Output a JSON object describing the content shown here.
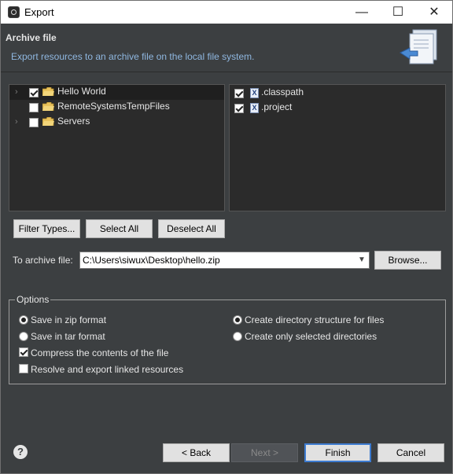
{
  "window": {
    "title": "Export",
    "controls": {
      "minimize": "—",
      "maximize": "☐",
      "close": "✕"
    }
  },
  "header": {
    "title": "Archive file",
    "description": "Export resources to an archive file on the local file system."
  },
  "left_tree": {
    "items": [
      {
        "label": "Hello World",
        "checked": true,
        "expander": true,
        "selected": true
      },
      {
        "label": "RemoteSystemsTempFiles",
        "checked": false,
        "expander": false,
        "selected": false
      },
      {
        "label": "Servers",
        "checked": false,
        "expander": true,
        "selected": false
      }
    ]
  },
  "right_list": {
    "items": [
      {
        "label": ".classpath",
        "checked": true,
        "icon": "X"
      },
      {
        "label": ".project",
        "checked": true,
        "icon": "X"
      }
    ]
  },
  "buttons": {
    "filter_types": "Filter Types...",
    "select_all": "Select All",
    "deselect_all": "Deselect All",
    "browse": "Browse..."
  },
  "archive": {
    "label": "To archive file:",
    "value": "C:\\Users\\siwux\\Desktop\\hello.zip"
  },
  "options": {
    "legend": "Options",
    "zip": "Save in zip format",
    "tar": "Save in tar format",
    "compress": "Compress the contents of the file",
    "resolve": "Resolve and export linked resources",
    "create_structure": "Create directory structure for files",
    "create_selected": "Create only selected directories",
    "zip_selected": true,
    "compress_checked": true,
    "resolve_checked": false,
    "structure_selected": true
  },
  "footer": {
    "help": "?",
    "back": "< Back",
    "next": "Next >",
    "finish": "Finish",
    "cancel": "Cancel"
  },
  "colors": {
    "dialog_bg": "#3c3f41",
    "panel_bg": "#2b2b2b",
    "description_text": "#8fb7e0",
    "default_button_border": "#3d7bd0"
  }
}
